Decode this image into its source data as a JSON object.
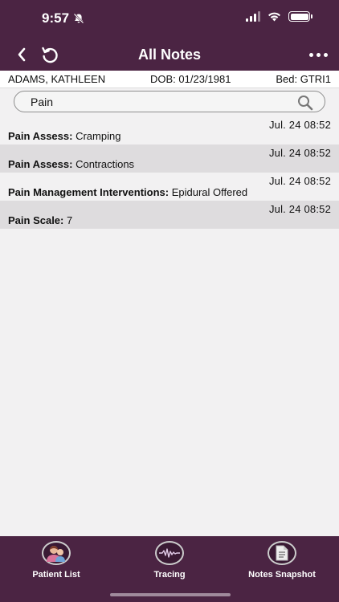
{
  "status_bar": {
    "time": "9:57"
  },
  "nav": {
    "title": "All Notes"
  },
  "patient": {
    "name": "ADAMS, KATHLEEN",
    "dob": "DOB: 01/23/1981",
    "bed": "Bed: GTRI1"
  },
  "search": {
    "value": "Pain"
  },
  "notes": [
    {
      "time": "Jul. 24 08:52",
      "label": "Pain Assess:",
      "value": "Cramping"
    },
    {
      "time": "Jul. 24 08:52",
      "label": "Pain Assess:",
      "value": "Contractions"
    },
    {
      "time": "Jul. 24 08:52",
      "label": "Pain Management Interventions:",
      "value": "Epidural Offered"
    },
    {
      "time": "Jul. 24 08:52",
      "label": "Pain Scale:",
      "value": "7"
    }
  ],
  "tabs": [
    {
      "label": "Patient List",
      "icon": "patient-avatar-icon"
    },
    {
      "label": "Tracing",
      "icon": "waveform-icon"
    },
    {
      "label": "Notes Snapshot",
      "icon": "document-icon"
    }
  ],
  "colors": {
    "header": "#4b2443",
    "row_shade": "#dedcde",
    "background": "#f2f1f2"
  }
}
